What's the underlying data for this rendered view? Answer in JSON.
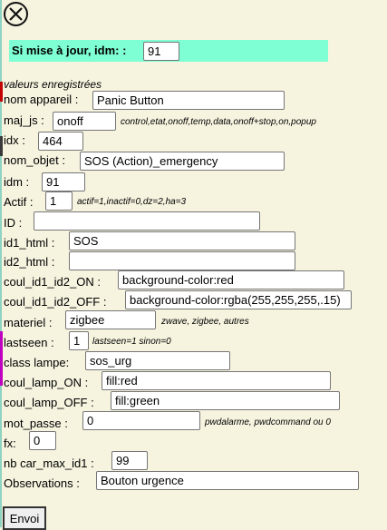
{
  "close": {
    "icon": "close-icon"
  },
  "header": {
    "label": "Si mise à jour, idm: :",
    "value": "91"
  },
  "section_title": "valeurs enregistrées",
  "fields": {
    "nom_appareil": {
      "label": "nom appareil :",
      "value": "Panic Button"
    },
    "maj_js": {
      "label": "maj_js :",
      "value": "onoff",
      "hint": "control,etat,onoff,temp,data,onoff+stop,on,popup"
    },
    "idx": {
      "label": "idx :",
      "value": "464"
    },
    "nom_objet": {
      "label": "nom_objet :",
      "value": "SOS (Action)_emergency"
    },
    "idm": {
      "label": "idm :",
      "value": "91"
    },
    "actif": {
      "label": "Actif :",
      "value": "1",
      "hint": "actif=1,inactif=0,dz=2,ha=3"
    },
    "id": {
      "label": "ID :",
      "value": ""
    },
    "id1_html": {
      "label": "id1_html :",
      "value": "SOS"
    },
    "id2_html": {
      "label": "id2_html :",
      "value": ""
    },
    "coul_id1_id2_on": {
      "label": "coul_id1_id2_ON :",
      "value": "background-color:red"
    },
    "coul_id1_id2_off": {
      "label": "coul_id1_id2_OFF :",
      "value": "background-color:rgba(255,255,255,.15)"
    },
    "materiel": {
      "label": "materiel :",
      "value": "zigbee",
      "hint": "zwave, zigbee, autres"
    },
    "lastseen": {
      "label": "lastseen :",
      "value": "1",
      "hint": "lastseen=1 sinon=0"
    },
    "class_lampe": {
      "label": "class lampe:",
      "value": "sos_urg"
    },
    "coul_lamp_on": {
      "label": "coul_lamp_ON :",
      "value": "fill:red"
    },
    "coul_lamp_off": {
      "label": "coul_lamp_OFF :",
      "value": "fill:green"
    },
    "mot_passe": {
      "label": "mot_passe :",
      "value": "0",
      "hint": "pwdalarme, pwdcommand ou 0"
    },
    "fx": {
      "label": "fx:",
      "value": "0"
    },
    "nb_car_max_id1": {
      "label": "nb car_max_id1 :",
      "value": "99"
    },
    "observations": {
      "label": "Observations :",
      "value": "Bouton urgence"
    }
  },
  "submit_label": "Envoi",
  "colors": {
    "background": "#f6f3df",
    "banner": "#7fffd4"
  }
}
